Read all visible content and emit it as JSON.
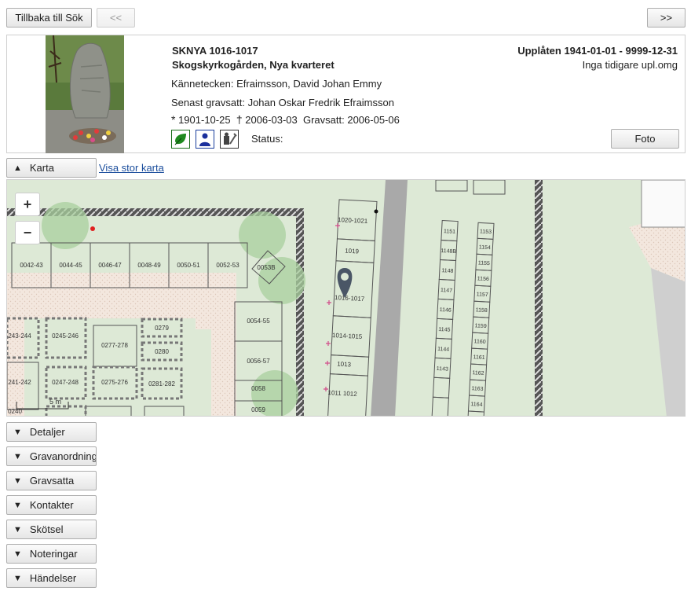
{
  "nav": {
    "back_label": "Tillbaka till Sök",
    "prev_label": "<<",
    "next_label": ">>"
  },
  "grave": {
    "id": "SKNYA 1016-1017",
    "location": "Skogskyrkogården, Nya kvarteret",
    "mark_label": "Kännetecken:",
    "mark_value": "Efraimsson, David Johan Emmy",
    "latest_label": "Senast gravsatt:",
    "latest_value": "Johan Oskar Fredrik Efraimsson",
    "born_symbol": "*",
    "born": "1901-10-25",
    "died_symbol": "†",
    "died": "2006-03-03",
    "buried_label": "Gravsatt:",
    "buried": "2006-05-06",
    "status_label": "Status:",
    "lease": "Upplåten 1941-01-01 - 9999-12-31",
    "lease_history": "Inga tidigare upl.omg",
    "photo_button": "Foto"
  },
  "icons": [
    "leaf-icon",
    "person-icon",
    "tools-icon"
  ],
  "map": {
    "toggle_label": "Karta",
    "large_map_link": "Visa stor karta",
    "zoom_in": "+",
    "zoom_out": "−",
    "scale_label": "5 m",
    "plots": {
      "row1": [
        "0042-43",
        "0044-45",
        "0046-47",
        "0048-49",
        "0050-51",
        "0052-53",
        "0053B"
      ],
      "col_mid": [
        "0054-55",
        "0056-57",
        "0058",
        "0059"
      ],
      "col_main": [
        "1020-1021",
        "1019",
        "1016-1017",
        "1014-1015",
        "1013",
        "1011 1012"
      ],
      "left_block": [
        "243-244",
        "0245-246",
        "0277-278",
        "0279",
        "0280",
        "241-242",
        "0247-248",
        "0275-276",
        "0281-282",
        "0240"
      ],
      "col_a": [
        "1151",
        "1148B",
        "1148",
        "1147",
        "1146",
        "1145",
        "1144",
        "1143"
      ],
      "col_b": [
        "1153",
        "1154",
        "1155",
        "1156",
        "1157",
        "1158",
        "1159",
        "1160",
        "1161",
        "1162",
        "1163",
        "1164"
      ]
    }
  },
  "sections": [
    "Detaljer",
    "Gravanordning",
    "Gravsatta",
    "Kontakter",
    "Skötsel",
    "Noteringar",
    "Händelser"
  ],
  "colors": {
    "map_green": "#dde9d6",
    "path_color": "#f3e6dd",
    "road_gray": "#a8a8a8",
    "marker": "#4a5666",
    "link": "#1a4d9c"
  }
}
